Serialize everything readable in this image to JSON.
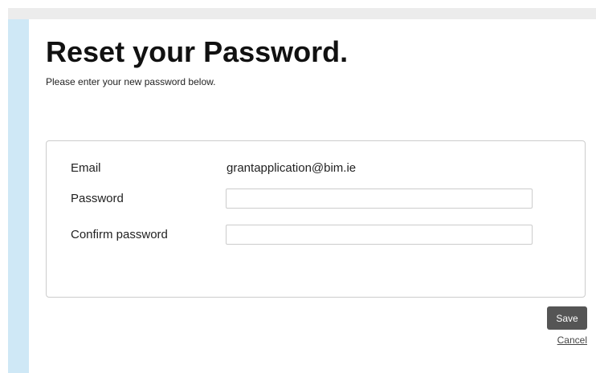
{
  "page": {
    "title": "Reset your Password.",
    "subtitle": "Please enter your new password below."
  },
  "form": {
    "email": {
      "label": "Email",
      "value": "grantapplication@bim.ie"
    },
    "password": {
      "label": "Password",
      "value": ""
    },
    "confirm_password": {
      "label": "Confirm password",
      "value": ""
    }
  },
  "actions": {
    "save_label": "Save",
    "cancel_label": "Cancel"
  },
  "colors": {
    "sidebar": "#cfe8f6",
    "save_button": "#555555",
    "top_bar": "#ececec"
  }
}
